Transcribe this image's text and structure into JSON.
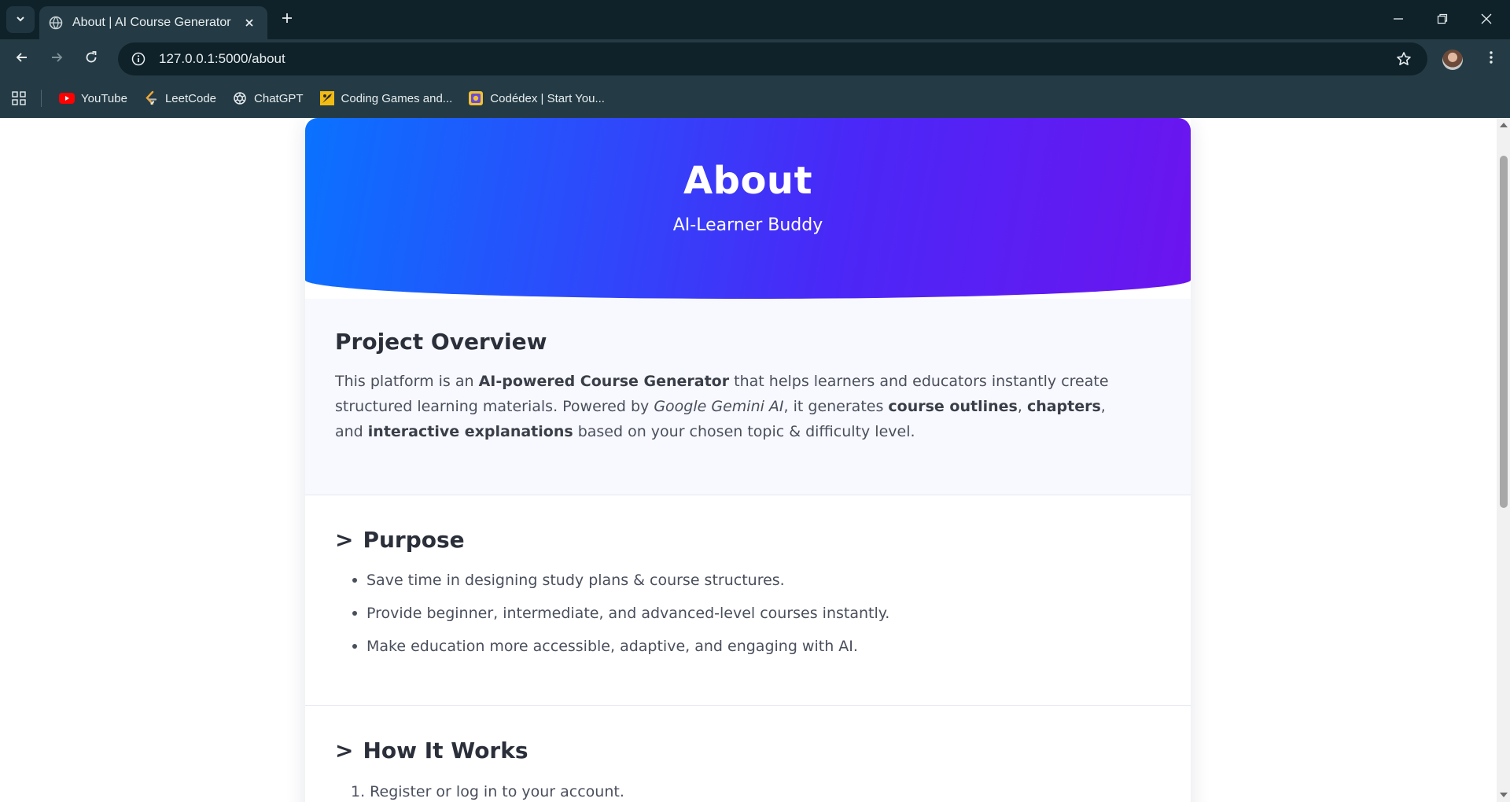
{
  "browser": {
    "tab_title": "About | AI Course Generator",
    "url": "127.0.0.1:5000/about",
    "bookmarks": [
      {
        "label": "YouTube",
        "icon": "youtube-icon"
      },
      {
        "label": "LeetCode",
        "icon": "leetcode-icon"
      },
      {
        "label": "ChatGPT",
        "icon": "chatgpt-icon"
      },
      {
        "label": "Coding Games and...",
        "icon": "codingame-icon"
      },
      {
        "label": "Codédex | Start You...",
        "icon": "codedex-icon"
      }
    ],
    "colors": {
      "frame": "#0f2229",
      "toolbar": "#243b45",
      "text": "#e8eef0"
    }
  },
  "hero": {
    "title": "About",
    "subtitle": "AI-Learner Buddy",
    "gradient": [
      "#0a72ff",
      "#6c14ef"
    ]
  },
  "overview": {
    "heading": "Project Overview",
    "text": {
      "p1": "This platform is an ",
      "b1": "AI-powered Course Generator",
      "p2": " that helps learners and educators instantly create structured learning materials. Powered by ",
      "i1": "Google Gemini AI",
      "p3": ", it generates ",
      "b2": "course outlines",
      "p4": ", ",
      "b3": "chapters",
      "p5": ", and ",
      "b4": "interactive explanations",
      "p6": " based on your chosen topic & difficulty level."
    }
  },
  "purpose": {
    "marker": ">",
    "heading": "Purpose",
    "items": [
      "Save time in designing study plans & course structures.",
      "Provide beginner, intermediate, and advanced-level courses instantly.",
      "Make education more accessible, adaptive, and engaging with AI."
    ]
  },
  "how_it_works": {
    "marker": ">",
    "heading": "How It Works",
    "steps": [
      "1. Register or log in to your account."
    ]
  }
}
